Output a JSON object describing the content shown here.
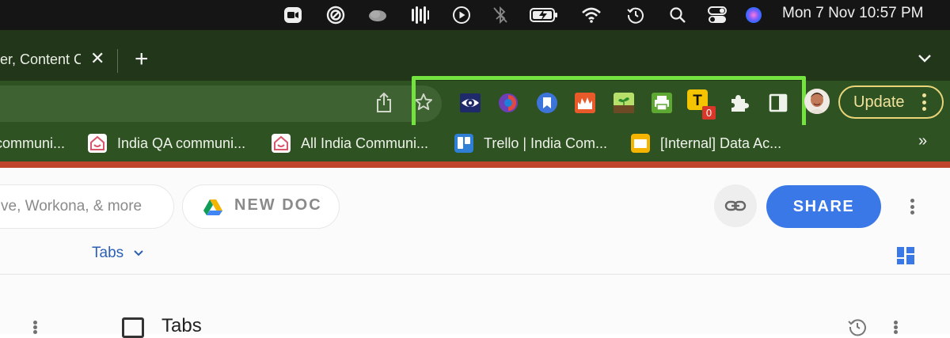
{
  "menubar": {
    "icons": [
      "zoom-icon",
      "focus-icon",
      "cloud-icon",
      "waveform-icon",
      "play-icon",
      "bluetooth-off-icon",
      "battery-charging-icon",
      "wifi-icon",
      "time-machine-icon",
      "search-icon",
      "control-center-icon",
      "siri-icon"
    ],
    "datetime": "Mon 7 Nov  10:57 PM"
  },
  "tabstrip": {
    "active_tab_title": "er, Content C",
    "close_glyph": "✕",
    "new_tab_glyph": "+",
    "tab_search_glyph": "⌄"
  },
  "toolbar": {
    "extensions": [
      "eye-extension-icon",
      "spiral-extension-icon",
      "bookmark-extension-icon",
      "fire-extension-icon",
      "plant-extension-icon",
      "printer-extension-icon",
      "t-extension-icon",
      "puzzle-icon",
      "side-panel-icon"
    ],
    "t_badge": "0",
    "update_label": "Update",
    "highlight_color": "#74e33f"
  },
  "bookmarks": {
    "items": [
      {
        "label": "communi..."
      },
      {
        "label": "India QA communi..."
      },
      {
        "label": "All India Communi..."
      },
      {
        "label": "Trello | India Com..."
      },
      {
        "label": "[Internal] Data Ac..."
      }
    ],
    "more_glyph": "»"
  },
  "page": {
    "search_placeholder": "ve, Workona, & more",
    "new_doc_label": "NEW DOC",
    "share_label": "SHARE",
    "tabs_dropdown_label": "Tabs",
    "tabs_dropdown_chevron": "⌄",
    "section_heading": "Tabs",
    "accent_color": "#3b78e7"
  }
}
